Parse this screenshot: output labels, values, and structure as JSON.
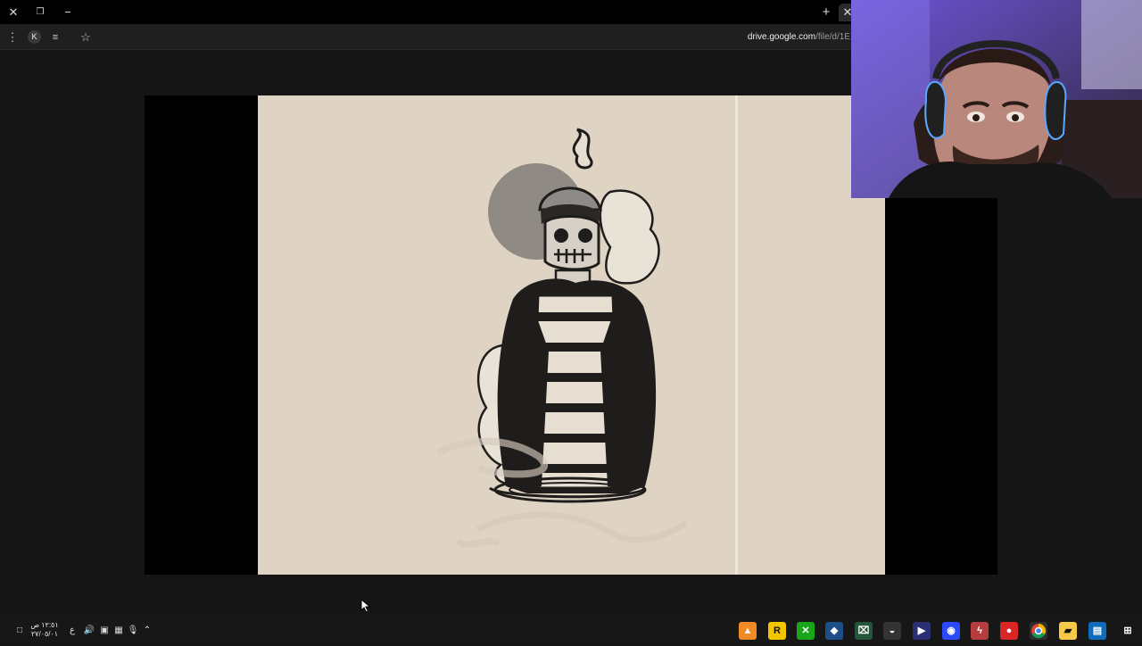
{
  "browser": {
    "url_host": "drive.google.com",
    "url_path": "/file/d/1E",
    "profile_initial": "K"
  },
  "taskbar": {
    "time": "١٢:٥١ ص",
    "date": "٢٧/٠٥/٠١",
    "language": "ع"
  },
  "icons": {
    "close": "close-icon",
    "restore": "restore-icon",
    "minimize": "minimize-icon",
    "new_tab": "plus-icon",
    "menu": "more-vertical-icon",
    "reading_list": "reading-list-icon",
    "bookmark": "star-icon",
    "cursor": "mouse-pointer-icon"
  },
  "colors": {
    "background": "#151515",
    "poster_paper": "#dfd3c4",
    "ink": "#1f1d1b"
  }
}
